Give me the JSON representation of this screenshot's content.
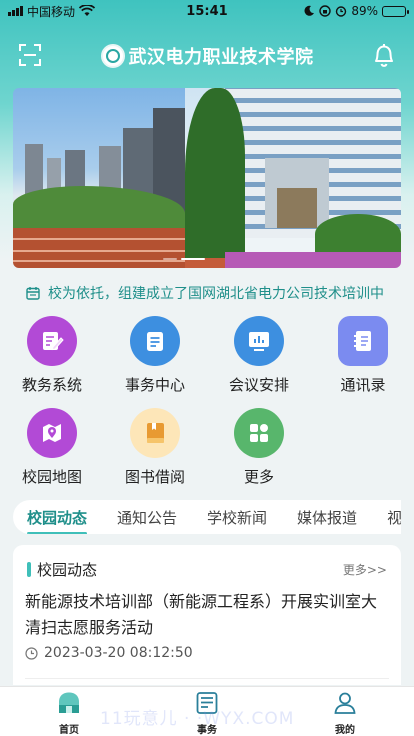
{
  "status_bar": {
    "carrier": "中国移动",
    "time": "15:41",
    "battery": "89%",
    "battery_level": 0.89
  },
  "header": {
    "title": "武汉电力职业技术学院"
  },
  "notice": {
    "text": "校为依托，组建成立了国网湖北省电力公司技术培训中"
  },
  "functions": [
    {
      "label": "教务系统",
      "icon": "edit-document-icon",
      "color": "#b24ad6"
    },
    {
      "label": "事务中心",
      "icon": "document-list-icon",
      "color": "#3d8fe0"
    },
    {
      "label": "会议安排",
      "icon": "chart-board-icon",
      "color": "#3d8fe0"
    },
    {
      "label": "通讯录",
      "icon": "notebook-icon",
      "color": "#7b8bf0"
    },
    {
      "label": "校园地图",
      "icon": "map-pin-icon",
      "color": "#b24ad6"
    },
    {
      "label": "图书借阅",
      "icon": "book-icon",
      "color": "#f0b440"
    },
    {
      "label": "更多",
      "icon": "grid-more-icon",
      "color": "#58b66c"
    }
  ],
  "tabs": [
    "校园动态",
    "通知公告",
    "学校新闻",
    "媒体报道",
    "视"
  ],
  "news": {
    "section_title": "校园动态",
    "more": "更多>>",
    "headline": "新能源技术培训部（新能源工程系）开展实训室大清扫志愿服务活动",
    "date": "2023-03-20 08:12:50"
  },
  "tabbar": {
    "home": "首页",
    "affairs": "事务",
    "mine": "我的"
  },
  "watermark": "11玩意儿 · ·WYX.COM",
  "colors": {
    "accent": "#3fbfb9",
    "accent_dark": "#1f8f8a"
  }
}
